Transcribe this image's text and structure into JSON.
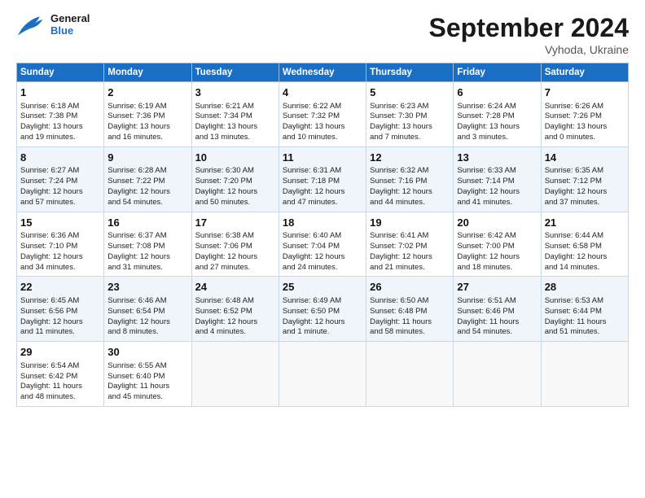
{
  "header": {
    "logo_general": "General",
    "logo_blue": "Blue",
    "month_title": "September 2024",
    "location": "Vyhoda, Ukraine"
  },
  "days_of_week": [
    "Sunday",
    "Monday",
    "Tuesday",
    "Wednesday",
    "Thursday",
    "Friday",
    "Saturday"
  ],
  "weeks": [
    [
      {
        "day": 1,
        "lines": [
          "Sunrise: 6:18 AM",
          "Sunset: 7:38 PM",
          "Daylight: 13 hours",
          "and 19 minutes."
        ]
      },
      {
        "day": 2,
        "lines": [
          "Sunrise: 6:19 AM",
          "Sunset: 7:36 PM",
          "Daylight: 13 hours",
          "and 16 minutes."
        ]
      },
      {
        "day": 3,
        "lines": [
          "Sunrise: 6:21 AM",
          "Sunset: 7:34 PM",
          "Daylight: 13 hours",
          "and 13 minutes."
        ]
      },
      {
        "day": 4,
        "lines": [
          "Sunrise: 6:22 AM",
          "Sunset: 7:32 PM",
          "Daylight: 13 hours",
          "and 10 minutes."
        ]
      },
      {
        "day": 5,
        "lines": [
          "Sunrise: 6:23 AM",
          "Sunset: 7:30 PM",
          "Daylight: 13 hours",
          "and 7 minutes."
        ]
      },
      {
        "day": 6,
        "lines": [
          "Sunrise: 6:24 AM",
          "Sunset: 7:28 PM",
          "Daylight: 13 hours",
          "and 3 minutes."
        ]
      },
      {
        "day": 7,
        "lines": [
          "Sunrise: 6:26 AM",
          "Sunset: 7:26 PM",
          "Daylight: 13 hours",
          "and 0 minutes."
        ]
      }
    ],
    [
      {
        "day": 8,
        "lines": [
          "Sunrise: 6:27 AM",
          "Sunset: 7:24 PM",
          "Daylight: 12 hours",
          "and 57 minutes."
        ]
      },
      {
        "day": 9,
        "lines": [
          "Sunrise: 6:28 AM",
          "Sunset: 7:22 PM",
          "Daylight: 12 hours",
          "and 54 minutes."
        ]
      },
      {
        "day": 10,
        "lines": [
          "Sunrise: 6:30 AM",
          "Sunset: 7:20 PM",
          "Daylight: 12 hours",
          "and 50 minutes."
        ]
      },
      {
        "day": 11,
        "lines": [
          "Sunrise: 6:31 AM",
          "Sunset: 7:18 PM",
          "Daylight: 12 hours",
          "and 47 minutes."
        ]
      },
      {
        "day": 12,
        "lines": [
          "Sunrise: 6:32 AM",
          "Sunset: 7:16 PM",
          "Daylight: 12 hours",
          "and 44 minutes."
        ]
      },
      {
        "day": 13,
        "lines": [
          "Sunrise: 6:33 AM",
          "Sunset: 7:14 PM",
          "Daylight: 12 hours",
          "and 41 minutes."
        ]
      },
      {
        "day": 14,
        "lines": [
          "Sunrise: 6:35 AM",
          "Sunset: 7:12 PM",
          "Daylight: 12 hours",
          "and 37 minutes."
        ]
      }
    ],
    [
      {
        "day": 15,
        "lines": [
          "Sunrise: 6:36 AM",
          "Sunset: 7:10 PM",
          "Daylight: 12 hours",
          "and 34 minutes."
        ]
      },
      {
        "day": 16,
        "lines": [
          "Sunrise: 6:37 AM",
          "Sunset: 7:08 PM",
          "Daylight: 12 hours",
          "and 31 minutes."
        ]
      },
      {
        "day": 17,
        "lines": [
          "Sunrise: 6:38 AM",
          "Sunset: 7:06 PM",
          "Daylight: 12 hours",
          "and 27 minutes."
        ]
      },
      {
        "day": 18,
        "lines": [
          "Sunrise: 6:40 AM",
          "Sunset: 7:04 PM",
          "Daylight: 12 hours",
          "and 24 minutes."
        ]
      },
      {
        "day": 19,
        "lines": [
          "Sunrise: 6:41 AM",
          "Sunset: 7:02 PM",
          "Daylight: 12 hours",
          "and 21 minutes."
        ]
      },
      {
        "day": 20,
        "lines": [
          "Sunrise: 6:42 AM",
          "Sunset: 7:00 PM",
          "Daylight: 12 hours",
          "and 18 minutes."
        ]
      },
      {
        "day": 21,
        "lines": [
          "Sunrise: 6:44 AM",
          "Sunset: 6:58 PM",
          "Daylight: 12 hours",
          "and 14 minutes."
        ]
      }
    ],
    [
      {
        "day": 22,
        "lines": [
          "Sunrise: 6:45 AM",
          "Sunset: 6:56 PM",
          "Daylight: 12 hours",
          "and 11 minutes."
        ]
      },
      {
        "day": 23,
        "lines": [
          "Sunrise: 6:46 AM",
          "Sunset: 6:54 PM",
          "Daylight: 12 hours",
          "and 8 minutes."
        ]
      },
      {
        "day": 24,
        "lines": [
          "Sunrise: 6:48 AM",
          "Sunset: 6:52 PM",
          "Daylight: 12 hours",
          "and 4 minutes."
        ]
      },
      {
        "day": 25,
        "lines": [
          "Sunrise: 6:49 AM",
          "Sunset: 6:50 PM",
          "Daylight: 12 hours",
          "and 1 minute."
        ]
      },
      {
        "day": 26,
        "lines": [
          "Sunrise: 6:50 AM",
          "Sunset: 6:48 PM",
          "Daylight: 11 hours",
          "and 58 minutes."
        ]
      },
      {
        "day": 27,
        "lines": [
          "Sunrise: 6:51 AM",
          "Sunset: 6:46 PM",
          "Daylight: 11 hours",
          "and 54 minutes."
        ]
      },
      {
        "day": 28,
        "lines": [
          "Sunrise: 6:53 AM",
          "Sunset: 6:44 PM",
          "Daylight: 11 hours",
          "and 51 minutes."
        ]
      }
    ],
    [
      {
        "day": 29,
        "lines": [
          "Sunrise: 6:54 AM",
          "Sunset: 6:42 PM",
          "Daylight: 11 hours",
          "and 48 minutes."
        ]
      },
      {
        "day": 30,
        "lines": [
          "Sunrise: 6:55 AM",
          "Sunset: 6:40 PM",
          "Daylight: 11 hours",
          "and 45 minutes."
        ]
      },
      null,
      null,
      null,
      null,
      null
    ]
  ]
}
